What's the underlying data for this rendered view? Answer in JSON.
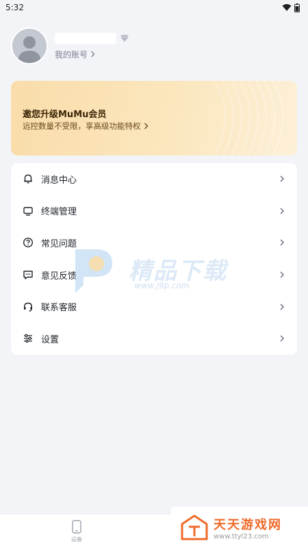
{
  "status_bar": {
    "time": "5:32"
  },
  "profile": {
    "account_link": "我的账号"
  },
  "vip_banner": {
    "title": "邀您升级MuMu会员",
    "subtitle": "远控数量不受限，享高级功能特权"
  },
  "menu": {
    "items": [
      {
        "label": "消息中心",
        "icon": "bell-icon"
      },
      {
        "label": "终端管理",
        "icon": "monitor-icon"
      },
      {
        "label": "常见问题",
        "icon": "question-circle-icon"
      },
      {
        "label": "意见反馈",
        "icon": "chat-bubble-icon"
      },
      {
        "label": "联系客服",
        "icon": "headset-icon"
      },
      {
        "label": "设置",
        "icon": "sliders-icon"
      }
    ]
  },
  "watermark": {
    "title": "精品下载",
    "url": "www.j9p.com"
  },
  "bottom_nav": {
    "device_label": "设备"
  },
  "corner_badge": {
    "title": "天天游戏网",
    "url": "www.ttyl23.com"
  },
  "colors": {
    "accent": "#f9ddaa",
    "badge_orange": "#ef6a2a"
  }
}
